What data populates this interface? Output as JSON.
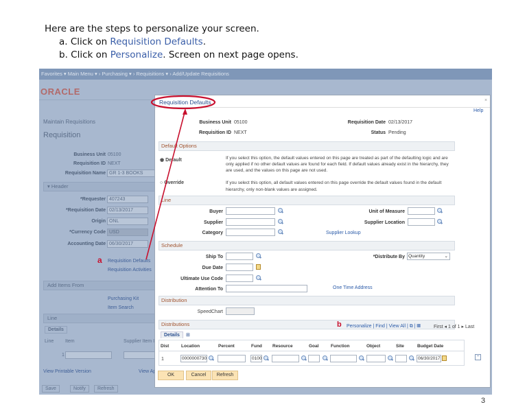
{
  "instructions": {
    "line1": "Here are the steps to personalize your screen.",
    "a_prefix": "a.  Click on ",
    "a_link": "Requisition Defaults",
    "a_suffix": ".",
    "b_prefix": "b.  Click on ",
    "b_link": "Personalize",
    "b_suffix": ". Screen on next page opens."
  },
  "nav": {
    "text": "Favorites ▾     Main Menu ▾  ›  Purchasing ▾  ›  Requisitions ▾  ›  Add/Update Requisitions"
  },
  "logo": "ORACLE",
  "bg": {
    "breadcrumb": "Maintain Requisitions",
    "title": "Requisition",
    "business_unit_label": "Business Unit",
    "business_unit": "05100",
    "req_id_label": "Requisition ID",
    "req_id": "NEXT",
    "req_name_label": "Requisition Name",
    "req_name": "GR 1-3 BOOKS",
    "header": "Header",
    "requester_label": "*Requester",
    "requester": "407243",
    "req_date_label": "*Requisition Date",
    "req_date": "02/13/2017",
    "origin_label": "Origin",
    "origin": "ONL",
    "currency_label": "*Currency Code",
    "currency": "USD",
    "acct_date_label": "Accounting Date",
    "acct_date": "06/30/2017",
    "marker_a": "a",
    "req_defaults_link": "Requisition Defaults",
    "req_activities_link": "Requisition Activities",
    "add_items": "Add Items From",
    "purchasing_kit": "Purchasing Kit",
    "item_search": "Item Search",
    "line": "Line",
    "details_tab": "Details",
    "col_line": "Line",
    "col_item": "Item",
    "col_supplier_item": "Supplier Item ID",
    "row_line": "1",
    "view_printable": "View Printable Version",
    "view_approvals": "View Ap",
    "save": "Save",
    "notify": "Notify",
    "refresh": "Refresh"
  },
  "modal": {
    "title": "Requisition Defaults",
    "close": "×",
    "help": "Help",
    "business_unit_label": "Business Unit",
    "business_unit": "05100",
    "req_date_label": "Requisition Date",
    "req_date": "02/13/2017",
    "req_id_label": "Requisition ID",
    "req_id": "NEXT",
    "status_label": "Status",
    "status": "Pending",
    "default_options": "Default Options",
    "default_label": "Default",
    "default_desc": "If you select this option, the default values entered on this page are treated as part of the defaulting logic and are only applied if no other default values are found for each field. If default values already exist in the hierarchy, they are used, and the values on this page are not used.",
    "override_label": "Override",
    "override_desc": "If you select this option, all default values entered on this page override the default values found in the default hierarchy, only non-blank values are assigned.",
    "line": "Line",
    "buyer": "Buyer",
    "supplier": "Supplier",
    "category": "Category",
    "uom": "Unit of Measure",
    "supplier_location": "Supplier Location",
    "supplier_lookup": "Supplier Lookup",
    "schedule": "Schedule",
    "ship_to": "Ship To",
    "due_date": "Due Date",
    "ultimate_use": "Ultimate Use Code",
    "attention_to": "Attention To",
    "distribute_by_label": "*Distribute By",
    "distribute_by": "Quantity",
    "one_time_address": "One Time Address",
    "distribution": "Distribution",
    "speedchart": "SpeedChart",
    "distributions": "Distributions",
    "marker_b": "b",
    "personalize": "Personalize",
    "find": "Find",
    "view_all": "View All",
    "first": "First",
    "count": "1 of 1",
    "last": "Last",
    "details_tab": "Details",
    "columns": [
      "Dist",
      "Location",
      "Percent",
      "Fund",
      "Resource",
      "Goal",
      "Function",
      "Object",
      "Site",
      "Budget Date"
    ],
    "row": {
      "dist": "1",
      "location": "0000000730",
      "percent": "",
      "fund": "0100",
      "resource": "",
      "goal": "",
      "function": "",
      "object": "",
      "site": "",
      "budget_date": "06/30/2017"
    },
    "ok": "OK",
    "cancel": "Cancel",
    "refresh": "Refresh"
  },
  "page_number": "3"
}
